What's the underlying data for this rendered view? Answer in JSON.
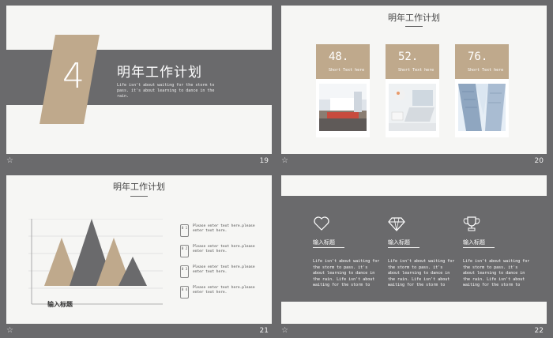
{
  "slides": {
    "s19": {
      "number": "19",
      "big_number": "4",
      "title": "明年工作计划",
      "subtitle": "Life isn't about waiting  for the storm to pass. it's about learning to dance in the rain."
    },
    "s20": {
      "number": "20",
      "title": "明年工作计划",
      "cards": [
        {
          "pct": "48.",
          "label": "Short Text here",
          "photo": "office-interior-photo"
        },
        {
          "pct": "52.",
          "label": "Short Text here",
          "photo": "desk-laptop-photo"
        },
        {
          "pct": "76.",
          "label": "Short Text here",
          "photo": "skyscraper-photo"
        }
      ]
    },
    "s21": {
      "number": "21",
      "title": "明年工作计划",
      "axis_label": "输入标题",
      "items": [
        {
          "badge": "0 1",
          "text": "Please enter text here.please enter text here."
        },
        {
          "badge": "0 2",
          "text": "Please enter text here.please enter text here."
        },
        {
          "badge": "0 3",
          "text": "Please enter text here.please enter text here."
        },
        {
          "badge": "0 4",
          "text": "Please enter text here.please enter text here."
        }
      ]
    },
    "s22": {
      "number": "22",
      "columns": [
        {
          "icon": "heart-icon",
          "title": "输入标题",
          "body": "Life isn't about waiting for the storm to pass. it's about learning to dance in the rain.   Life isn't about waiting for the storm to"
        },
        {
          "icon": "diamond-icon",
          "title": "输入标题",
          "body": "Life isn't about waiting for the storm to pass. it's about learning to dance in the rain.   Life isn't about waiting for the storm to"
        },
        {
          "icon": "trophy-icon",
          "title": "输入标题",
          "body": "Life isn't about waiting for the storm to pass. it's about learning to dance in the rain.   Life isn't about waiting for the storm to"
        }
      ]
    }
  },
  "footer_icon": "star-icon",
  "colors": {
    "background": "#6a6a6c",
    "slide": "#f6f6f4",
    "accent_tan": "#bfa98c",
    "accent_gray": "#6a6a6c"
  }
}
